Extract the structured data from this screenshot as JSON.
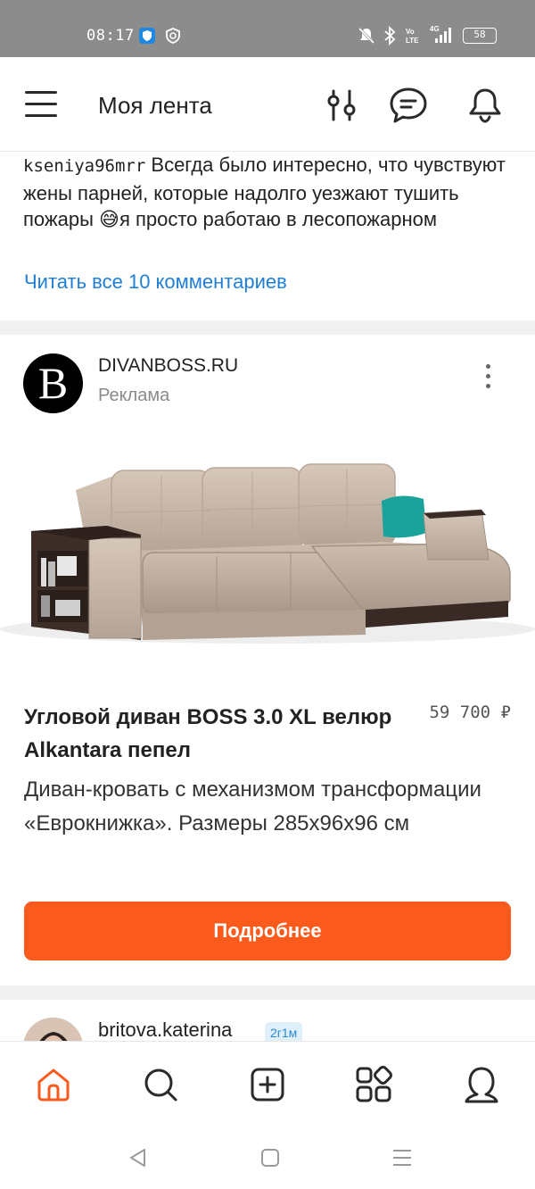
{
  "status_bar": {
    "time": "08:17",
    "battery": "58",
    "icons": [
      "shield-icon",
      "clock-icon",
      "mute-icon",
      "bluetooth-icon",
      "volte-icon",
      "4g-signal-icon",
      "battery-icon"
    ]
  },
  "header": {
    "title": "Моя лента",
    "icons": [
      "menu-icon",
      "filter-icon",
      "chat-icon",
      "bell-icon"
    ]
  },
  "comment": {
    "username": "kseniya96mrr",
    "text": " Всегда было интересно, что чувствуют жены парней, которые надолго уезжают тушить пожары 😅я просто работаю в лесопожарном",
    "read_all": "Читать все 10 комментариев"
  },
  "ad_post": {
    "avatar_letter": "B",
    "author": "DIVANBOSS.RU",
    "label": "Реклама",
    "product_title": "Угловой диван BOSS 3.0 XL велюр Alkantara пепел",
    "price": "59 700 ₽",
    "description": "Диван-кровать с механизмом трансформации «Еврокнижка». Размеры 285x96x96 см",
    "cta": "Подробнее"
  },
  "next_post": {
    "author": "britova.katerina",
    "badge": "2г1м"
  },
  "bottom_nav": [
    "home-icon",
    "search-icon",
    "add-icon",
    "apps-icon",
    "profile-icon"
  ],
  "colors": {
    "accent": "#fa5a1c",
    "link": "#1f7fd6",
    "status_bar": "#8c8c8c"
  }
}
